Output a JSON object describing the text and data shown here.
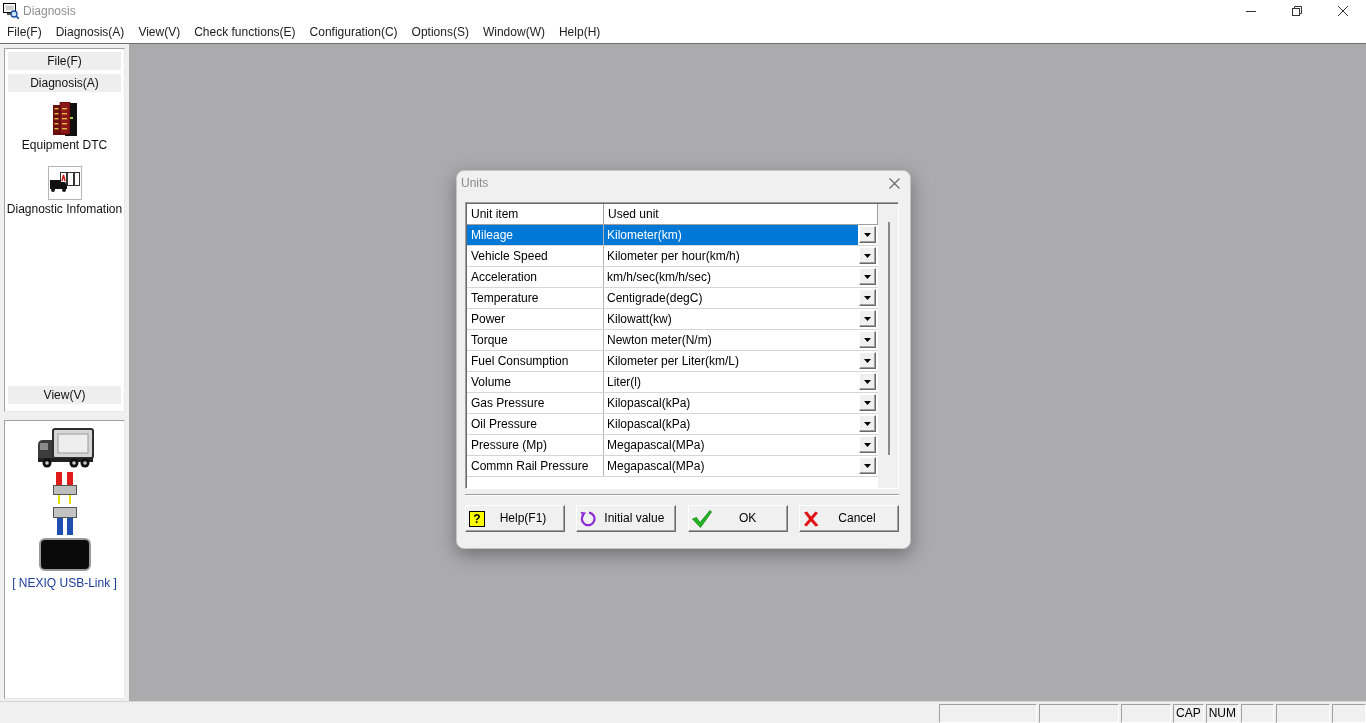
{
  "window": {
    "title": "Diagnosis"
  },
  "menu": [
    "File(F)",
    "Diagnosis(A)",
    "View(V)",
    "Check functions(E)",
    "Configuration(C)",
    "Options(S)",
    "Window(W)",
    "Help(H)"
  ],
  "sidebar": {
    "groups": [
      {
        "label": "File(F)"
      },
      {
        "label": "Diagnosis(A)",
        "items": [
          {
            "kind": "dtc",
            "label": "Equipment DTC"
          },
          {
            "kind": "info",
            "label": "Diagnostic Infomation"
          }
        ]
      },
      {
        "label": "View(V)"
      }
    ]
  },
  "device_panel": {
    "label": "[ NEXIQ USB-Link ]"
  },
  "dialog": {
    "title": "Units",
    "columns": [
      "Unit item",
      "Used unit"
    ],
    "rows": [
      {
        "item": "Mileage",
        "unit": "Kilometer(km)",
        "selected": true
      },
      {
        "item": "Vehicle Speed",
        "unit": "Kilometer per hour(km/h)",
        "selected": false
      },
      {
        "item": "Acceleration",
        "unit": "km/h/sec(km/h/sec)",
        "selected": false
      },
      {
        "item": "Temperature",
        "unit": "Centigrade(degC)",
        "selected": false
      },
      {
        "item": "Power",
        "unit": "Kilowatt(kw)",
        "selected": false
      },
      {
        "item": "Torque",
        "unit": "Newton meter(N/m)",
        "selected": false
      },
      {
        "item": "Fuel Consumption",
        "unit": "Kilometer per Liter(km/L)",
        "selected": false
      },
      {
        "item": "Volume",
        "unit": "Liter(l)",
        "selected": false
      },
      {
        "item": "Gas Pressure",
        "unit": "Kilopascal(kPa)",
        "selected": false
      },
      {
        "item": "Oil Pressure",
        "unit": "Kilopascal(kPa)",
        "selected": false
      },
      {
        "item": "Pressure (Mp)",
        "unit": "Megapascal(MPa)",
        "selected": false
      },
      {
        "item": "Commn Rail Pressure",
        "unit": "Megapascal(MPa)",
        "selected": false
      }
    ],
    "buttons": [
      {
        "kind": "help",
        "label": "Help(F1)",
        "icon_text": "?"
      },
      {
        "kind": "reset",
        "label": "Initial value"
      },
      {
        "kind": "ok",
        "label": "OK"
      },
      {
        "kind": "cancel",
        "label": "Cancel"
      }
    ]
  },
  "status_bar": {
    "indicators": [
      "CAP",
      "NUM"
    ]
  }
}
